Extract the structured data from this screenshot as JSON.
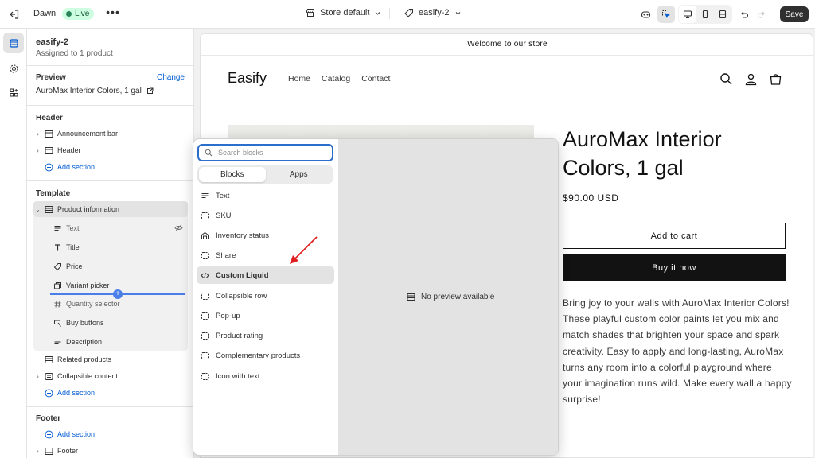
{
  "topbar": {
    "theme_name": "Dawn",
    "live_badge": "Live",
    "store_selector": "Store default",
    "template_selector": "easify-2",
    "save_label": "Save"
  },
  "sidebar": {
    "template_name": "easify-2",
    "assigned_text": "Assigned to 1 product",
    "preview_heading": "Preview",
    "change_link": "Change",
    "preview_product": "AuroMax Interior Colors, 1 gal",
    "header_heading": "Header",
    "header_items": [
      "Announcement bar",
      "Header"
    ],
    "add_section": "Add section",
    "template_heading": "Template",
    "product_information": "Product information",
    "product_blocks": [
      "Text",
      "Title",
      "Price",
      "Variant picker",
      "Quantity selector",
      "Buy buttons",
      "Description"
    ],
    "template_items": [
      "Related products",
      "Collapsible content"
    ],
    "footer_heading": "Footer",
    "footer_items": [
      "Footer"
    ]
  },
  "storefront": {
    "announcement": "Welcome to our store",
    "logo": "Easify",
    "nav": [
      "Home",
      "Catalog",
      "Contact"
    ],
    "product_title": "AuroMax Interior Colors, 1 gal",
    "price": "$90.00 USD",
    "add_to_cart": "Add to cart",
    "buy_now": "Buy it now",
    "description": "Bring joy to your walls with AuroMax Interior Colors! These playful custom color paints let you mix and match shades that brighten your space and spark creativity. Easy to apply and long-lasting, AuroMax turns any room into a colorful playground where your imagination runs wild. Make every wall a happy surprise!"
  },
  "picker": {
    "search_placeholder": "Search blocks",
    "tabs": [
      "Blocks",
      "Apps"
    ],
    "blocks": [
      "Text",
      "SKU",
      "Inventory status",
      "Share",
      "Custom Liquid",
      "Collapsible row",
      "Pop-up",
      "Product rating",
      "Complementary products",
      "Icon with text"
    ],
    "selected_block": "Custom Liquid",
    "no_preview": "No preview available"
  },
  "colors": {
    "accent_blue": "#005bd3",
    "focus_blue": "#2c6ecb",
    "live_green": "#29845a",
    "arrow_red": "#e02020"
  }
}
